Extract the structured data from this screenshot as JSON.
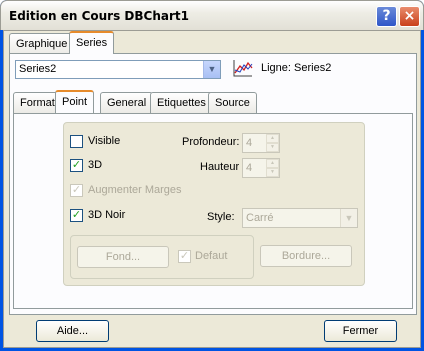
{
  "window": {
    "title": "Edition en Cours DBChart1",
    "help_icon": "?",
    "close_icon": "×"
  },
  "outer_tabs": [
    {
      "label": "Graphique",
      "active": false
    },
    {
      "label": "Series",
      "active": true
    }
  ],
  "series_selector": {
    "value": "Series2",
    "arrow": "▼"
  },
  "series_info": {
    "label": "Ligne: Series2",
    "icon": "line-chart-icon"
  },
  "inner_tabs": [
    {
      "label": "Format",
      "active": false
    },
    {
      "label": "Point",
      "active": true
    },
    {
      "label": "General",
      "active": false
    },
    {
      "label": "Etiquettes",
      "active": false
    },
    {
      "label": "Source",
      "active": false
    }
  ],
  "point": {
    "visible": {
      "label": "Visible",
      "checked": false
    },
    "three_d": {
      "label": "3D",
      "checked": true
    },
    "augmenter_marges": {
      "label": "Augmenter Marges",
      "checked": true,
      "enabled": false
    },
    "three_d_noir": {
      "label": "3D Noir",
      "checked": true
    },
    "profondeur": {
      "label": "Profondeur:",
      "value": "4"
    },
    "hauteur": {
      "label": "Hauteur",
      "value": "4"
    },
    "style": {
      "label": "Style:",
      "value": "Carré"
    },
    "fond_button": "Fond...",
    "defaut": {
      "label": "Defaut",
      "checked": true,
      "enabled": false
    },
    "bordure_button": "Bordure..."
  },
  "footer": {
    "aide_button": "Aide...",
    "fermer_button": "Fermer"
  },
  "colors": {
    "titlebar_frame": "#0054e3",
    "dialog_bg": "#ece9d8",
    "active_tab_accent": "#e68b2c",
    "check": "#21a121"
  }
}
